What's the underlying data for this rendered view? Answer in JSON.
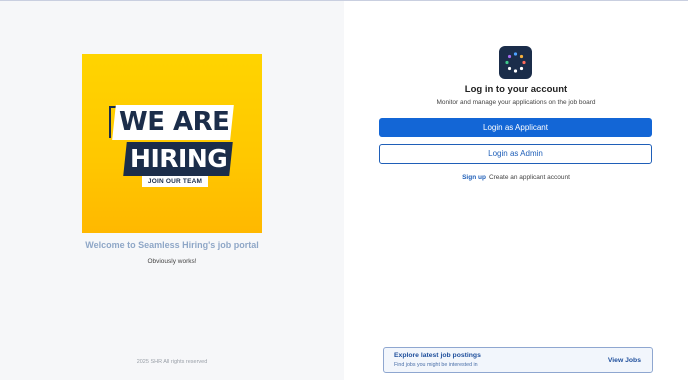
{
  "left": {
    "banner": {
      "line1": "WE ARE",
      "line2": "HIRING",
      "line3": "JOIN OUR TEAM"
    },
    "welcome": "Welcome to Seamless Hiring's job portal",
    "tagline": "Obviously works!",
    "copyright": "2025 SHR All rights reserved"
  },
  "right": {
    "logo_icon": "dotted-circle-logo",
    "title": "Log in to your account",
    "subtitle": "Monitor and manage your applications on the job board",
    "login_applicant": "Login as Applicant",
    "login_admin": "Login as Admin",
    "signup_link": "Sign up",
    "signup_text": "Create an applicant account",
    "jobs_card": {
      "title": "Explore latest job postings",
      "subtitle": "Find jobs you might be interested in",
      "link": "View Jobs"
    }
  },
  "colors": {
    "primary": "#1366d6",
    "navy": "#1b2d4a",
    "banner_yellow": "#ffd400"
  }
}
